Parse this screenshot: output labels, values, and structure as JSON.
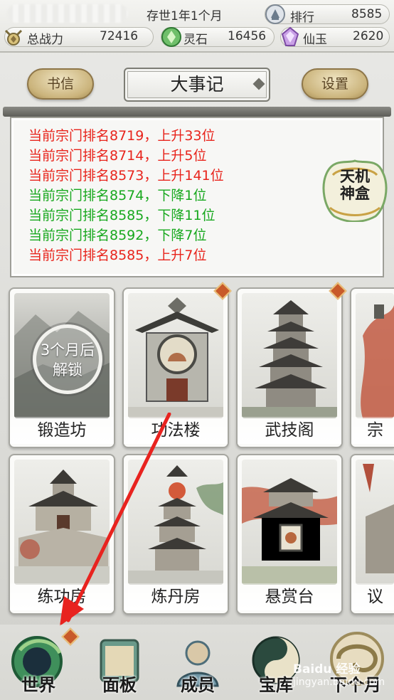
{
  "status": {
    "era": "存世1年1个月",
    "rank_label": "排行",
    "rank_value": "8585",
    "power_label": "总战力",
    "power_value": "72416",
    "lingshi_label": "灵石",
    "lingshi_value": "16456",
    "xianyu_label": "仙玉",
    "xianyu_value": "2620"
  },
  "header": {
    "letters_label": "书信",
    "title": "大事记",
    "settings_label": "设置"
  },
  "log": [
    {
      "text": "当前宗门排名8719，上升33位",
      "trend": "up"
    },
    {
      "text": "当前宗门排名8714，上升5位",
      "trend": "up"
    },
    {
      "text": "当前宗门排名8573，上升141位",
      "trend": "up"
    },
    {
      "text": "当前宗门排名8574，下降1位",
      "trend": "down"
    },
    {
      "text": "当前宗门排名8585，下降11位",
      "trend": "down"
    },
    {
      "text": "当前宗门排名8592，下降7位",
      "trend": "down"
    },
    {
      "text": "当前宗门排名8585，上升7位",
      "trend": "up"
    }
  ],
  "tianji": {
    "line1": "天机",
    "line2": "神盒"
  },
  "buildings_row1": [
    {
      "label": "锻造坊",
      "locked_text_1": "3个月后",
      "locked_text_2": "解锁"
    },
    {
      "label": "功法楼"
    },
    {
      "label": "武技阁"
    },
    {
      "label": "宗门"
    }
  ],
  "buildings_row2": [
    {
      "label": "练功房"
    },
    {
      "label": "炼丹房"
    },
    {
      "label": "悬赏台"
    },
    {
      "label": "议事"
    }
  ],
  "nav": {
    "world": "世界",
    "panel": "面板",
    "members": "成员",
    "treasury": "宝库",
    "next_month": "下个月"
  },
  "watermark": {
    "line1": "Baidu 经验",
    "line2": "jingyan.baidu.com"
  },
  "colors": {
    "rise": "#e8241c",
    "fall": "#18a81e",
    "gold": "#cbb47c",
    "arrow": "#e8231f"
  }
}
